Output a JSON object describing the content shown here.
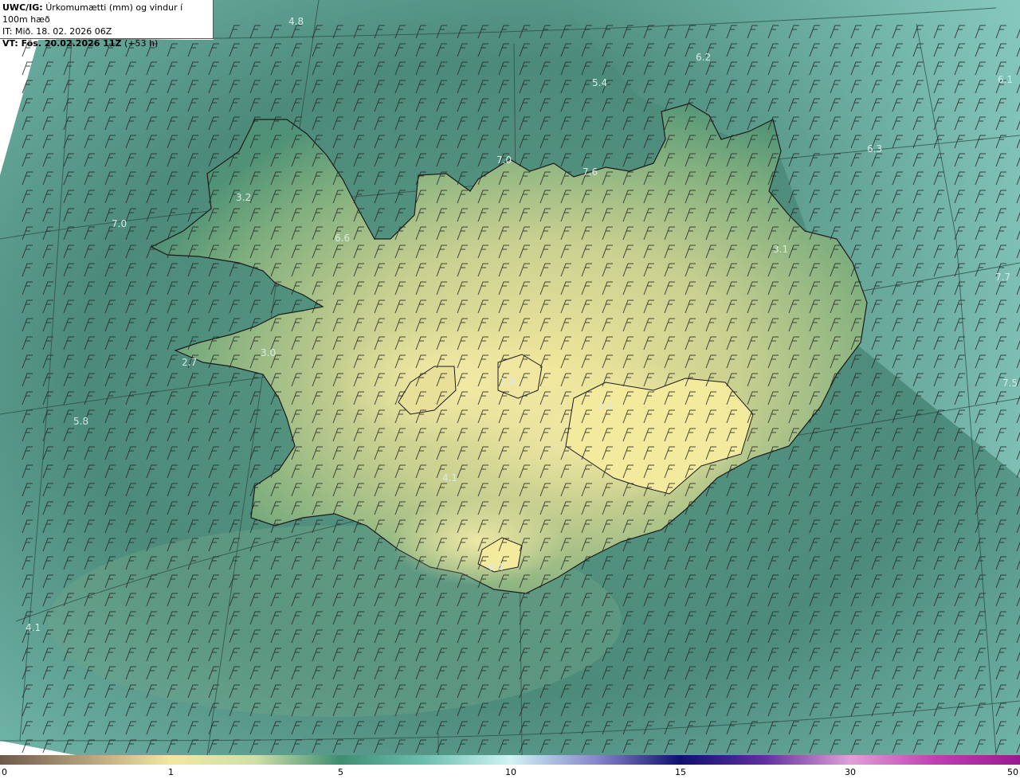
{
  "header": {
    "model_label": "UWC/IG:",
    "title": "Úrkomumætti (mm) og vindur í 100m hæð",
    "init_time": "IT: Mið. 18. 02. 2026 06Z",
    "valid_label": "VT: Fös. 20.02.2026 11Z",
    "valid_offset": "(+53 h)"
  },
  "colorbar": {
    "ticks": [
      {
        "label": "0",
        "value": 0
      },
      {
        "label": "1",
        "value": 1
      },
      {
        "label": "5",
        "value": 5
      },
      {
        "label": "10",
        "value": 10
      },
      {
        "label": "15",
        "value": 15
      },
      {
        "label": "30",
        "value": 30
      },
      {
        "label": "50",
        "value": 50
      }
    ],
    "colors": [
      "#6e5a4a",
      "#b3a07a",
      "#f2e8a0",
      "#cfe0a8",
      "#3e8e72",
      "#6cc0b0",
      "#d0f4f4",
      "#8888cc",
      "#101070",
      "#6030a0",
      "#e0a0d8",
      "#c040b0",
      "#9a1a90"
    ]
  },
  "labels": [
    {
      "text": "4.8"
    },
    {
      "text": "5.4"
    },
    {
      "text": "6.2"
    },
    {
      "text": "6.1"
    },
    {
      "text": "6.3"
    },
    {
      "text": "7.0"
    },
    {
      "text": "7.6"
    },
    {
      "text": "3.2"
    },
    {
      "text": "7.0"
    },
    {
      "text": "6.6"
    },
    {
      "text": "3.1"
    },
    {
      "text": "7.7"
    },
    {
      "text": "3.0"
    },
    {
      "text": "2.7"
    },
    {
      "text": "1.0"
    },
    {
      "text": "5.8"
    },
    {
      "text": "0.8"
    },
    {
      "text": "7.5"
    },
    {
      "text": "4.1"
    },
    {
      "text": "0.4"
    },
    {
      "text": "4.1"
    }
  ],
  "colors": {
    "sea": "#4f8e7e",
    "land_low": "#5fa07c",
    "land_high": "#f0e6a0",
    "coastline": "#1a1a1a",
    "wind_barb": "#2a2a2a"
  }
}
